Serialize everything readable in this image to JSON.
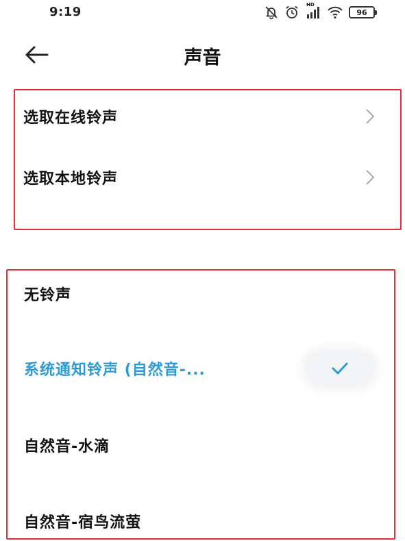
{
  "status_bar": {
    "time": "9:19",
    "battery_level": "96",
    "network_label": "HD",
    "icons": [
      "bell-off-icon",
      "alarm-icon",
      "signal-icon",
      "wifi-icon",
      "battery-icon"
    ]
  },
  "header": {
    "title": "声音",
    "back_icon": "arrow-left-icon"
  },
  "ringtone_sources": [
    {
      "label": "选取在线铃声",
      "icon": "chevron-right-icon"
    },
    {
      "label": "选取本地铃声",
      "icon": "chevron-right-icon"
    }
  ],
  "ringtones": [
    {
      "label": "无铃声",
      "selected": false
    },
    {
      "label": "系统通知铃声 (自然音-...",
      "selected": true
    },
    {
      "label": "自然音-水滴",
      "selected": false
    },
    {
      "label": "自然音-宿鸟流萤",
      "selected": false
    }
  ],
  "colors": {
    "selected_text": "#2b9ad6",
    "highlight_frame": "#e2303a",
    "text": "#111111"
  }
}
